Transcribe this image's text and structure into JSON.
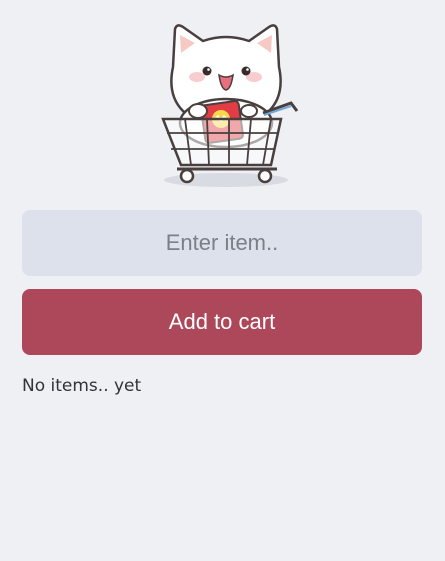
{
  "mascot": {
    "icon": "cat-in-shopping-cart-icon"
  },
  "input": {
    "value": "",
    "placeholder": "Enter item.."
  },
  "add_button": {
    "label": "Add to cart"
  },
  "list": {
    "empty_text": "No items.. yet"
  },
  "colors": {
    "background": "#eef0f4",
    "input_background": "#dce1eb",
    "button_background": "#ac485a",
    "button_text": "#ffffff"
  }
}
